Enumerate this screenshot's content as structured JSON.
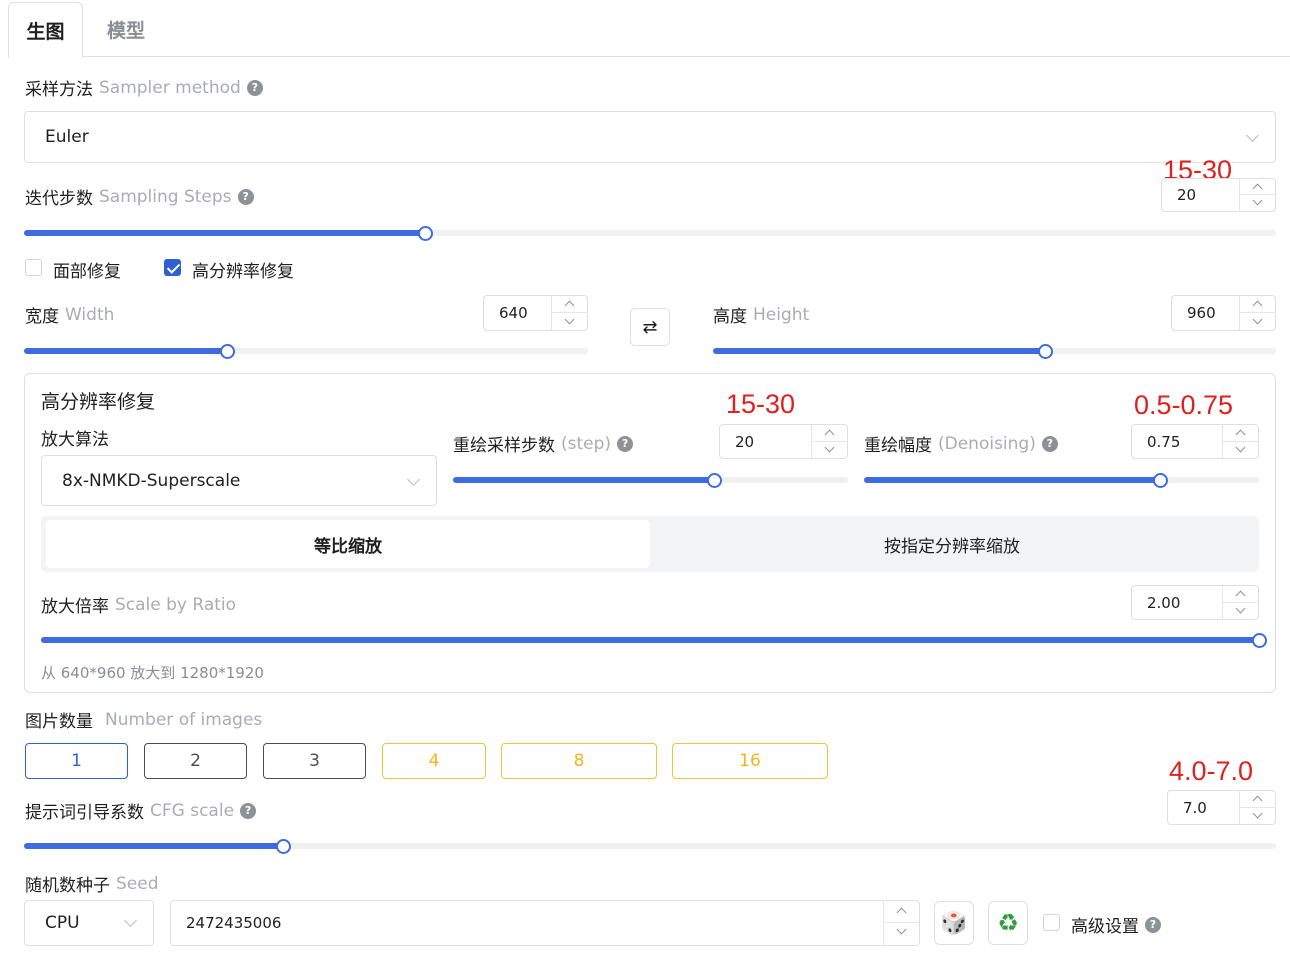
{
  "tabs": {
    "generate": "生图",
    "model": "模型"
  },
  "sampler": {
    "label_cn": "采样方法",
    "label_en": "Sampler method",
    "value": "Euler"
  },
  "steps": {
    "label_cn": "迭代步数",
    "label_en": "Sampling Steps",
    "value": "20",
    "annotation": "15-30",
    "fraction": 0.32
  },
  "checkboxes": {
    "face_fix": {
      "label": "面部修复",
      "checked": false
    },
    "hires_fix": {
      "label": "高分辨率修复",
      "checked": true
    }
  },
  "width": {
    "label_cn": "宽度",
    "label_en": "Width",
    "value": "640",
    "fraction": 0.36
  },
  "height": {
    "label_cn": "高度",
    "label_en": "Height",
    "value": "960",
    "fraction": 0.59
  },
  "swap_icon": "⇄",
  "hires": {
    "title": "高分辨率修复",
    "upscaler": {
      "label": "放大算法",
      "value": "8x-NMKD-Superscale"
    },
    "steps": {
      "label_cn": "重绘采样步数",
      "label_en": "(step)",
      "value": "20",
      "annotation": "15-30",
      "fraction": 0.66
    },
    "denoise": {
      "label_cn": "重绘幅度",
      "label_en": "(Denoising)",
      "value": "0.75",
      "annotation": "0.5-0.75",
      "fraction": 0.75
    },
    "mode_ratio": "等比缩放",
    "mode_resolution": "按指定分辨率缩放",
    "scale": {
      "label_cn": "放大倍率",
      "label_en": "Scale by Ratio",
      "value": "2.00",
      "fraction": 1.0
    },
    "hint": "从 640*960 放大到 1280*1920"
  },
  "images": {
    "label_cn": "图片数量",
    "label_en": "Number of images",
    "options": [
      "1",
      "2",
      "3",
      "4",
      "8",
      "16"
    ],
    "selected": "1"
  },
  "cfg": {
    "label_cn": "提示词引导系数",
    "label_en": "CFG scale",
    "value": "7.0",
    "annotation": "4.0-7.0",
    "fraction": 0.207
  },
  "seed": {
    "label_cn": "随机数种子",
    "label_en": "Seed",
    "device": "CPU",
    "value": "2472435006",
    "dice_icon": "🎲",
    "recycle_icon": "♻",
    "advanced_label": "高级设置"
  },
  "colors": {
    "accent": "#3e6ce0",
    "gold": "#f2b51a",
    "annotation_red": "#e0201e"
  }
}
